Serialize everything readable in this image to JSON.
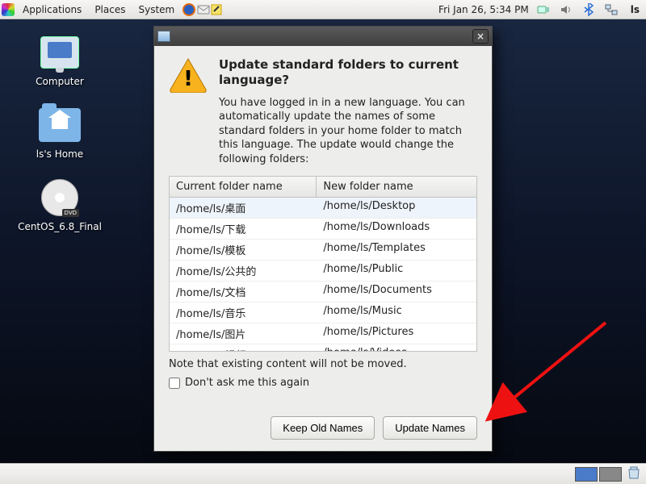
{
  "panel": {
    "menus": [
      "Applications",
      "Places",
      "System"
    ],
    "clock": "Fri Jan 26,  5:34 PM",
    "user": "ls"
  },
  "desktop": {
    "icons": [
      {
        "label": "Computer"
      },
      {
        "label": "ls's Home"
      },
      {
        "label": "CentOS_6.8_Final"
      }
    ]
  },
  "dialog": {
    "heading": "Update standard folders to current language?",
    "message": "You have logged in in a new language. You can automatically update the names of some standard folders in your home folder to match this language. The update would change the following folders:",
    "columns": {
      "current": "Current folder name",
      "next": "New folder name"
    },
    "rows": [
      {
        "current": "/home/ls/桌面",
        "next": "/home/ls/Desktop"
      },
      {
        "current": "/home/ls/下载",
        "next": "/home/ls/Downloads"
      },
      {
        "current": "/home/ls/模板",
        "next": "/home/ls/Templates"
      },
      {
        "current": "/home/ls/公共的",
        "next": "/home/ls/Public"
      },
      {
        "current": "/home/ls/文档",
        "next": "/home/ls/Documents"
      },
      {
        "current": "/home/ls/音乐",
        "next": "/home/ls/Music"
      },
      {
        "current": "/home/ls/图片",
        "next": "/home/ls/Pictures"
      },
      {
        "current": "/home/ls/视频",
        "next": "/home/ls/Videos"
      }
    ],
    "note": "Note that existing content will not be moved.",
    "dont_ask": "Don't ask me this again",
    "keep_btn": "Keep Old Names",
    "update_btn": "Update Names"
  }
}
